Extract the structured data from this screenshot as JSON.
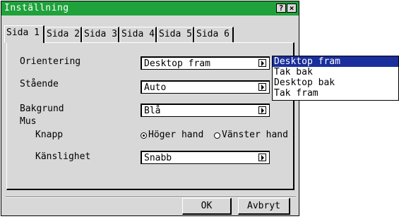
{
  "window": {
    "title": "Inställning",
    "help_label": "?",
    "close_label": "×"
  },
  "tabs": [
    {
      "label": "Sida 1",
      "active": true
    },
    {
      "label": "Sida 2",
      "active": false
    },
    {
      "label": "Sida 3",
      "active": false
    },
    {
      "label": "Sida 4",
      "active": false
    },
    {
      "label": "Sida 5",
      "active": false
    },
    {
      "label": "Sida 6",
      "active": false
    }
  ],
  "settings": {
    "orientation": {
      "label": "Orientering",
      "value": "Desktop fram"
    },
    "standing": {
      "label": "Stående",
      "value": "Auto"
    },
    "background": {
      "label": "Bakgrund",
      "value": "Blå"
    },
    "mouse": {
      "label": "Mus",
      "button": {
        "label": "Knapp",
        "options": [
          {
            "label": "Höger hand",
            "selected": true
          },
          {
            "label": "Vänster hand",
            "selected": false
          }
        ]
      },
      "sensitivity": {
        "label": "Känslighet",
        "value": "Snabb"
      }
    }
  },
  "dropdown": {
    "items": [
      {
        "label": "Desktop fram",
        "selected": true
      },
      {
        "label": "Tak bak",
        "selected": false
      },
      {
        "label": "Desktop bak",
        "selected": false
      },
      {
        "label": "Tak fram",
        "selected": false
      }
    ]
  },
  "buttons": {
    "ok": "OK",
    "cancel": "Avbryt"
  },
  "colors": {
    "titlebar": "#1fa23b",
    "selection": "#1a2f9c",
    "dialog_bg": "#d8d8d8"
  }
}
